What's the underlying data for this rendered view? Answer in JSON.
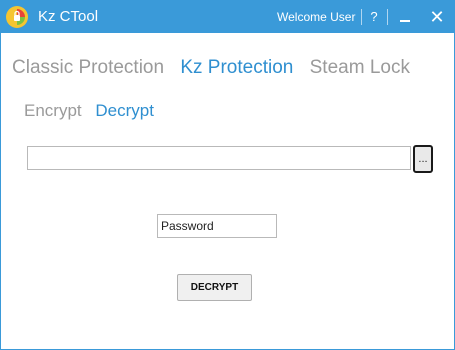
{
  "window": {
    "title": "Kz CTool",
    "welcome_text": "Welcome User",
    "help_label": "?",
    "minimize_icon": "minimize-icon",
    "close_label": "✕"
  },
  "main_tabs": [
    {
      "label": "Classic Protection",
      "active": false
    },
    {
      "label": "Kz Protection",
      "active": true
    },
    {
      "label": "Steam Lock",
      "active": false
    }
  ],
  "sub_tabs": [
    {
      "label": "Encrypt",
      "active": false
    },
    {
      "label": "Decrypt",
      "active": true
    }
  ],
  "file_path": {
    "value": "",
    "browse_label": "..."
  },
  "password": {
    "value": "Password"
  },
  "action": {
    "decrypt_label": "DECRYPT"
  },
  "colors": {
    "accent": "#3a9ad9",
    "active_tab": "#2f8fd0",
    "inactive_tab": "#9a9a9a"
  }
}
